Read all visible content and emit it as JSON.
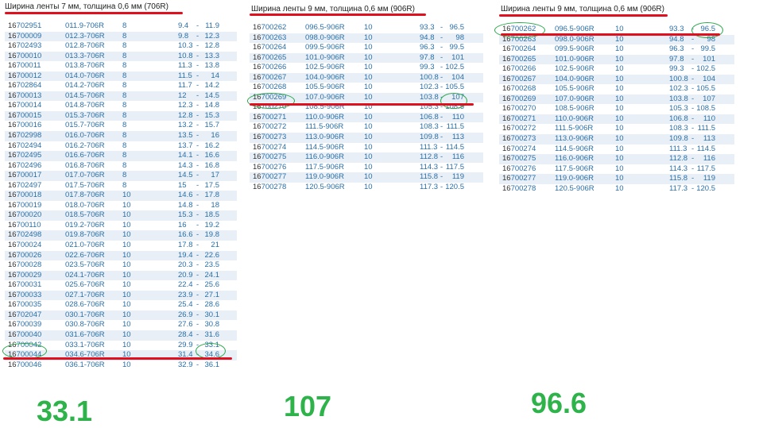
{
  "panels": [
    {
      "title": "Ширина ленты 7 мм, толщина 0,6 мм (706R)",
      "rows": [
        [
          "16702951",
          "011.9-706R",
          "8",
          "9.4",
          "-",
          "11.9"
        ],
        [
          "16700009",
          "012.3-706R",
          "8",
          "9.8",
          "-",
          "12.3"
        ],
        [
          "16702493",
          "012.8-706R",
          "8",
          "10.3",
          "-",
          "12.8"
        ],
        [
          "16700010",
          "013.3-706R",
          "8",
          "10.8",
          "-",
          "13.3"
        ],
        [
          "16700011",
          "013.8-706R",
          "8",
          "11.3",
          "-",
          "13.8"
        ],
        [
          "16700012",
          "014.0-706R",
          "8",
          "11.5",
          "-",
          "14"
        ],
        [
          "16702864",
          "014.2-706R",
          "8",
          "11.7",
          "-",
          "14.2"
        ],
        [
          "16700013",
          "014.5-706R",
          "8",
          "12",
          "-",
          "14.5"
        ],
        [
          "16700014",
          "014.8-706R",
          "8",
          "12.3",
          "-",
          "14.8"
        ],
        [
          "16700015",
          "015.3-706R",
          "8",
          "12.8",
          "-",
          "15.3"
        ],
        [
          "16700016",
          "015.7-706R",
          "8",
          "13.2",
          "-",
          "15.7"
        ],
        [
          "16702998",
          "016.0-706R",
          "8",
          "13.5",
          "-",
          "16"
        ],
        [
          "16702494",
          "016.2-706R",
          "8",
          "13.7",
          "-",
          "16.2"
        ],
        [
          "16702495",
          "016.6-706R",
          "8",
          "14.1",
          "-",
          "16.6"
        ],
        [
          "16702496",
          "016.8-706R",
          "8",
          "14.3",
          "-",
          "16.8"
        ],
        [
          "16700017",
          "017.0-706R",
          "8",
          "14.5",
          "-",
          "17"
        ],
        [
          "16702497",
          "017.5-706R",
          "8",
          "15",
          "-",
          "17.5"
        ],
        [
          "16700018",
          "017.8-706R",
          "10",
          "14.6",
          "-",
          "17.8"
        ],
        [
          "16700019",
          "018.0-706R",
          "10",
          "14.8",
          "-",
          "18"
        ],
        [
          "16700020",
          "018.5-706R",
          "10",
          "15.3",
          "-",
          "18.5"
        ],
        [
          "16700110",
          "019.2-706R",
          "10",
          "16",
          "-",
          "19.2"
        ],
        [
          "16702498",
          "019.8-706R",
          "10",
          "16.6",
          "-",
          "19.8"
        ],
        [
          "16700024",
          "021.0-706R",
          "10",
          "17.8",
          "-",
          "21"
        ],
        [
          "16700026",
          "022.6-706R",
          "10",
          "19.4",
          "-",
          "22.6"
        ],
        [
          "16700028",
          "023.5-706R",
          "10",
          "20.3",
          "-",
          "23.5"
        ],
        [
          "16700029",
          "024.1-706R",
          "10",
          "20.9",
          "-",
          "24.1"
        ],
        [
          "16700031",
          "025.6-706R",
          "10",
          "22.4",
          "-",
          "25.6"
        ],
        [
          "16700033",
          "027.1-706R",
          "10",
          "23.9",
          "-",
          "27.1"
        ],
        [
          "16700035",
          "028.6-706R",
          "10",
          "25.4",
          "-",
          "28.6"
        ],
        [
          "16702047",
          "030.1-706R",
          "10",
          "26.9",
          "-",
          "30.1"
        ],
        [
          "16700039",
          "030.8-706R",
          "10",
          "27.6",
          "-",
          "30.8"
        ],
        [
          "16700040",
          "031.6-706R",
          "10",
          "28.4",
          "-",
          "31.6"
        ],
        [
          "16700042",
          "033.1-706R",
          "10",
          "29.9",
          "-",
          "33.1"
        ],
        [
          "16700044",
          "034.6-706R",
          "10",
          "31.4",
          "-",
          "34.6"
        ],
        [
          "16700046",
          "036.1-706R",
          "10",
          "32.9",
          "-",
          "36.1"
        ]
      ],
      "highlight_value": "33.1"
    },
    {
      "title": "Ширина ленты 9 мм, толщина 0,6 мм (906R)",
      "rows": [
        [
          "16700262",
          "096.5-906R",
          "10",
          "93.3",
          "-",
          "96.5"
        ],
        [
          "16700263",
          "098.0-906R",
          "10",
          "94.8",
          "-",
          "98"
        ],
        [
          "16700264",
          "099.5-906R",
          "10",
          "96.3",
          "-",
          "99.5"
        ],
        [
          "16700265",
          "101.0-906R",
          "10",
          "97.8",
          "-",
          "101"
        ],
        [
          "16700266",
          "102.5-906R",
          "10",
          "99.3",
          "-",
          "102.5"
        ],
        [
          "16700267",
          "104.0-906R",
          "10",
          "100.8",
          "-",
          "104"
        ],
        [
          "16700268",
          "105.5-906R",
          "10",
          "102.3",
          "-",
          "105.5"
        ],
        [
          "16700269",
          "107.0-906R",
          "10",
          "103.8",
          "-",
          "107"
        ],
        [
          "16700270",
          "108.5-906R",
          "10",
          "105.3",
          "-",
          "108.5"
        ],
        [
          "16700271",
          "110.0-906R",
          "10",
          "106.8",
          "-",
          "110"
        ],
        [
          "16700272",
          "111.5-906R",
          "10",
          "108.3",
          "-",
          "111.5"
        ],
        [
          "16700273",
          "113.0-906R",
          "10",
          "109.8",
          "-",
          "113"
        ],
        [
          "16700274",
          "114.5-906R",
          "10",
          "111.3",
          "-",
          "114.5"
        ],
        [
          "16700275",
          "116.0-906R",
          "10",
          "112.8",
          "-",
          "116"
        ],
        [
          "16700276",
          "117.5-906R",
          "10",
          "114.3",
          "-",
          "117.5"
        ],
        [
          "16700277",
          "119.0-906R",
          "10",
          "115.8",
          "-",
          "119"
        ],
        [
          "16700278",
          "120.5-906R",
          "10",
          "117.3",
          "-",
          "120.5"
        ]
      ],
      "highlight_value": "107"
    },
    {
      "title": "Ширина ленты 9 мм, толщина 0,6 мм (906R)",
      "rows": [
        [
          "16700262",
          "096.5-906R",
          "10",
          "93.3",
          "-",
          "96.5"
        ],
        [
          "16700263",
          "098.0-906R",
          "10",
          "94.8",
          "-",
          "98"
        ],
        [
          "16700264",
          "099.5-906R",
          "10",
          "96.3",
          "-",
          "99.5"
        ],
        [
          "16700265",
          "101.0-906R",
          "10",
          "97.8",
          "-",
          "101"
        ],
        [
          "16700266",
          "102.5-906R",
          "10",
          "99.3",
          "-",
          "102.5"
        ],
        [
          "16700267",
          "104.0-906R",
          "10",
          "100.8",
          "-",
          "104"
        ],
        [
          "16700268",
          "105.5-906R",
          "10",
          "102.3",
          "-",
          "105.5"
        ],
        [
          "16700269",
          "107.0-906R",
          "10",
          "103.8",
          "-",
          "107"
        ],
        [
          "16700270",
          "108.5-906R",
          "10",
          "105.3",
          "-",
          "108.5"
        ],
        [
          "16700271",
          "110.0-906R",
          "10",
          "106.8",
          "-",
          "110"
        ],
        [
          "16700272",
          "111.5-906R",
          "10",
          "108.3",
          "-",
          "111.5"
        ],
        [
          "16700273",
          "113.0-906R",
          "10",
          "109.8",
          "-",
          "113"
        ],
        [
          "16700274",
          "114.5-906R",
          "10",
          "111.3",
          "-",
          "114.5"
        ],
        [
          "16700275",
          "116.0-906R",
          "10",
          "112.8",
          "-",
          "116"
        ],
        [
          "16700276",
          "117.5-906R",
          "10",
          "114.3",
          "-",
          "117.5"
        ],
        [
          "16700277",
          "119.0-906R",
          "10",
          "115.8",
          "-",
          "119"
        ],
        [
          "16700278",
          "120.5-906R",
          "10",
          "117.3",
          "-",
          "120.5"
        ]
      ],
      "highlight_value": "96.5"
    }
  ],
  "results": [
    "33.1",
    "107",
    "96.6"
  ],
  "colors": {
    "link_blue": "#2a6fa8",
    "row_alt": "#e8eff6",
    "red_mark": "#e0101e",
    "green_mark": "#2aa84a",
    "result_green": "#2db34a"
  }
}
